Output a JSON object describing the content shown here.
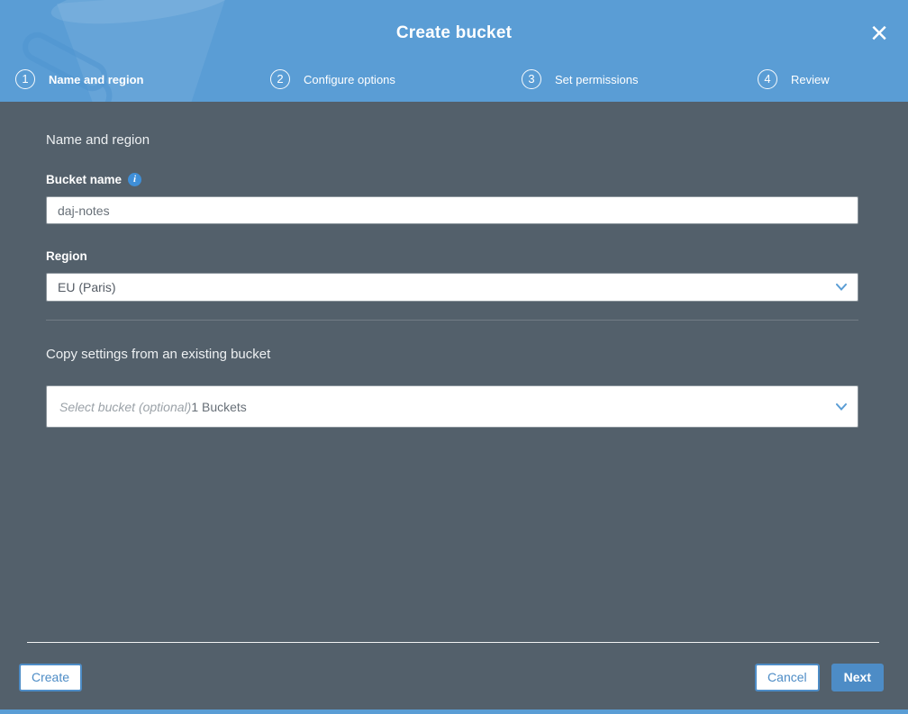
{
  "header": {
    "title": "Create bucket",
    "steps": [
      {
        "num": "1",
        "label": "Name and region",
        "active": true
      },
      {
        "num": "2",
        "label": "Configure options",
        "active": false
      },
      {
        "num": "3",
        "label": "Set permissions",
        "active": false
      },
      {
        "num": "4",
        "label": "Review",
        "active": false
      }
    ]
  },
  "icons": {
    "close": "×",
    "info": "i",
    "chevron_down": "chevron-down",
    "bucket_watermark": "s3-bucket"
  },
  "form": {
    "section_heading": "Name and region",
    "bucket_name": {
      "label": "Bucket name",
      "value": "daj-notes"
    },
    "region": {
      "label": "Region",
      "selected": "EU (Paris)"
    },
    "copy_settings": {
      "heading": "Copy settings from an existing bucket",
      "placeholder": "Select bucket (optional)",
      "suffix": "1 Buckets"
    }
  },
  "footer": {
    "create_label": "Create",
    "cancel_label": "Cancel",
    "next_label": "Next"
  },
  "colors": {
    "header_blue": "#5A9DD5",
    "body_slate": "#53606B",
    "accent_blue": "#4D8CC6",
    "info_blue": "#3F8FD8"
  }
}
